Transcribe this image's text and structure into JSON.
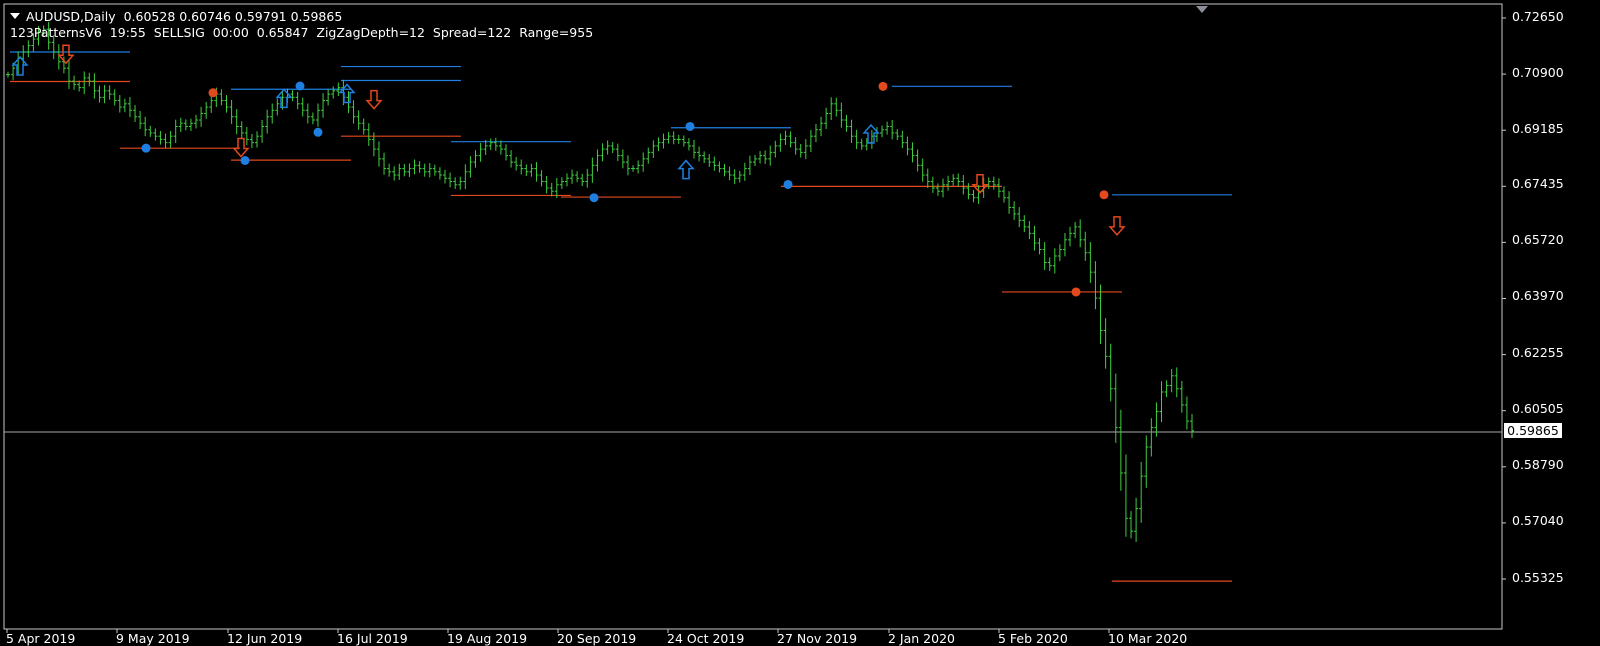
{
  "header": {
    "symbol_line": "AUDUSD,Daily  0.60528 0.60746 0.59791 0.59865",
    "indicator_line": "123PatternsV6  19:55  SELLSIG  00:00  0.65847  ZigZagDepth=12  Spread=122  Range=955"
  },
  "colors": {
    "background": "#000000",
    "bars": "#3fcf3f",
    "resistance": "#1e7fe0",
    "support": "#e2491e",
    "grid_frame": "#c8c8c8",
    "price_line": "#a8a8a8"
  },
  "chart_data": {
    "type": "ohlc",
    "symbol": "AUDUSD",
    "timeframe": "Daily",
    "x_ticks": [
      "5 Apr 2019",
      "9 May 2019",
      "12 Jun 2019",
      "16 Jul 2019",
      "19 Aug 2019",
      "20 Sep 2019",
      "24 Oct 2019",
      "27 Nov 2019",
      "2 Jan 2020",
      "5 Feb 2020",
      "10 Mar 2020"
    ],
    "y_ticks": [
      "0.72650",
      "0.70900",
      "0.69185",
      "0.67435",
      "0.65720",
      "0.63970",
      "0.62255",
      "0.60505",
      "0.58790",
      "0.57040",
      "0.55325"
    ],
    "ylim": [
      0.549,
      0.727
    ],
    "current_price": "0.59865",
    "current_price_value": 0.59865,
    "close_series": [
      0.709,
      0.711,
      0.714,
      0.716,
      0.718,
      0.72,
      0.722,
      0.723,
      0.719,
      0.716,
      0.713,
      0.711,
      0.707,
      0.706,
      0.705,
      0.708,
      0.707,
      0.704,
      0.702,
      0.704,
      0.703,
      0.701,
      0.699,
      0.7,
      0.698,
      0.696,
      0.694,
      0.692,
      0.691,
      0.69,
      0.689,
      0.688,
      0.69,
      0.693,
      0.694,
      0.693,
      0.694,
      0.695,
      0.697,
      0.699,
      0.701,
      0.703,
      0.701,
      0.699,
      0.696,
      0.693,
      0.691,
      0.689,
      0.688,
      0.69,
      0.693,
      0.696,
      0.698,
      0.7,
      0.702,
      0.703,
      0.702,
      0.7,
      0.698,
      0.696,
      0.695,
      0.698,
      0.701,
      0.703,
      0.704,
      0.705,
      0.702,
      0.699,
      0.696,
      0.694,
      0.692,
      0.689,
      0.686,
      0.683,
      0.68,
      0.679,
      0.678,
      0.68,
      0.679,
      0.68,
      0.681,
      0.68,
      0.679,
      0.68,
      0.679,
      0.678,
      0.677,
      0.676,
      0.675,
      0.676,
      0.679,
      0.682,
      0.684,
      0.686,
      0.687,
      0.688,
      0.687,
      0.686,
      0.684,
      0.682,
      0.681,
      0.68,
      0.679,
      0.68,
      0.678,
      0.676,
      0.674,
      0.673,
      0.675,
      0.676,
      0.677,
      0.678,
      0.677,
      0.676,
      0.678,
      0.681,
      0.684,
      0.686,
      0.687,
      0.686,
      0.684,
      0.682,
      0.68,
      0.68,
      0.681,
      0.683,
      0.685,
      0.687,
      0.688,
      0.689,
      0.69,
      0.689,
      0.689,
      0.688,
      0.687,
      0.685,
      0.684,
      0.683,
      0.682,
      0.681,
      0.68,
      0.679,
      0.678,
      0.677,
      0.678,
      0.68,
      0.682,
      0.683,
      0.684,
      0.683,
      0.685,
      0.687,
      0.689,
      0.69,
      0.688,
      0.686,
      0.685,
      0.687,
      0.69,
      0.692,
      0.694,
      0.697,
      0.7,
      0.698,
      0.695,
      0.693,
      0.69,
      0.688,
      0.687,
      0.688,
      0.69,
      0.691,
      0.692,
      0.693,
      0.691,
      0.69,
      0.688,
      0.686,
      0.684,
      0.681,
      0.678,
      0.676,
      0.674,
      0.673,
      0.675,
      0.676,
      0.677,
      0.676,
      0.674,
      0.672,
      0.671,
      0.673,
      0.675,
      0.676,
      0.675,
      0.673,
      0.671,
      0.668,
      0.666,
      0.664,
      0.662,
      0.66,
      0.657,
      0.655,
      0.651,
      0.65,
      0.653,
      0.655,
      0.658,
      0.66,
      0.662,
      0.658,
      0.654,
      0.648,
      0.64,
      0.63,
      0.622,
      0.612,
      0.6,
      0.586,
      0.572,
      0.568,
      0.575,
      0.585,
      0.594,
      0.6,
      0.605,
      0.611,
      0.613,
      0.616,
      0.612,
      0.607,
      0.602,
      0.599
    ],
    "resistance_lines": [
      {
        "y": 0.716,
        "from": "5 Apr 2019",
        "to": "9 May 2019"
      },
      {
        "y": 0.7045,
        "from": "12 Jun 2019",
        "to": "12 Jun 2019"
      },
      {
        "y": 0.7072,
        "from": "16 Jul 2019",
        "to": "16 Jul 2019"
      },
      {
        "y": 0.7115,
        "from": "16 Jul 2019",
        "to": "19 Aug 2019"
      },
      {
        "y": 0.6883,
        "from": "19 Aug 2019",
        "to": "20 Sep 2019"
      },
      {
        "y": 0.6926,
        "from": "24 Oct 2019",
        "to": "27 Nov 2019"
      },
      {
        "y": 0.7054,
        "from": "2 Jan 2020",
        "to": "5 Feb 2020"
      },
      {
        "y": 0.6719,
        "from": "10 Mar 2020",
        "to": "10 Mar 2020"
      }
    ],
    "support_lines": [
      {
        "y": 0.7069,
        "from": "5 Apr 2019",
        "to": "9 May 2019"
      },
      {
        "y": 0.6863,
        "from": "9 May 2019",
        "to": "12 Jun 2019"
      },
      {
        "y": 0.6826,
        "from": "12 Jun 2019",
        "to": "12 Jun 2019"
      },
      {
        "y": 0.69,
        "from": "16 Jul 2019",
        "to": "16 Jul 2019"
      },
      {
        "y": 0.6717,
        "from": "19 Aug 2019",
        "to": "20 Sep 2019"
      },
      {
        "y": 0.6712,
        "from": "20 Sep 2019",
        "to": "24 Oct 2019"
      },
      {
        "y": 0.6745,
        "from": "27 Nov 2019",
        "to": "5 Feb 2020"
      },
      {
        "y": 0.6419,
        "from": "5 Feb 2020",
        "to": "10 Mar 2020"
      },
      {
        "y": 0.5526,
        "from": "10 Mar 2020",
        "to": "10 Mar 2020"
      }
    ],
    "pivot_points": [
      {
        "type": "high",
        "y": 0.7034
      },
      {
        "type": "high",
        "y": 0.7054
      },
      {
        "type": "high",
        "y": 0.6719
      },
      {
        "type": "high",
        "y": 0.6419
      },
      {
        "type": "low",
        "y": 0.6863
      },
      {
        "type": "low",
        "y": 0.6825
      },
      {
        "type": "low",
        "y": 0.7055
      },
      {
        "type": "low",
        "y": 0.6912
      },
      {
        "type": "low",
        "y": 0.671
      },
      {
        "type": "low",
        "y": 0.693
      },
      {
        "type": "low",
        "y": 0.6751
      }
    ],
    "signals": [
      {
        "type": "buy"
      },
      {
        "type": "sell"
      },
      {
        "type": "sell"
      },
      {
        "type": "buy"
      },
      {
        "type": "buy"
      },
      {
        "type": "sell"
      },
      {
        "type": "buy"
      },
      {
        "type": "buy"
      },
      {
        "type": "sell"
      },
      {
        "type": "sell"
      }
    ]
  }
}
